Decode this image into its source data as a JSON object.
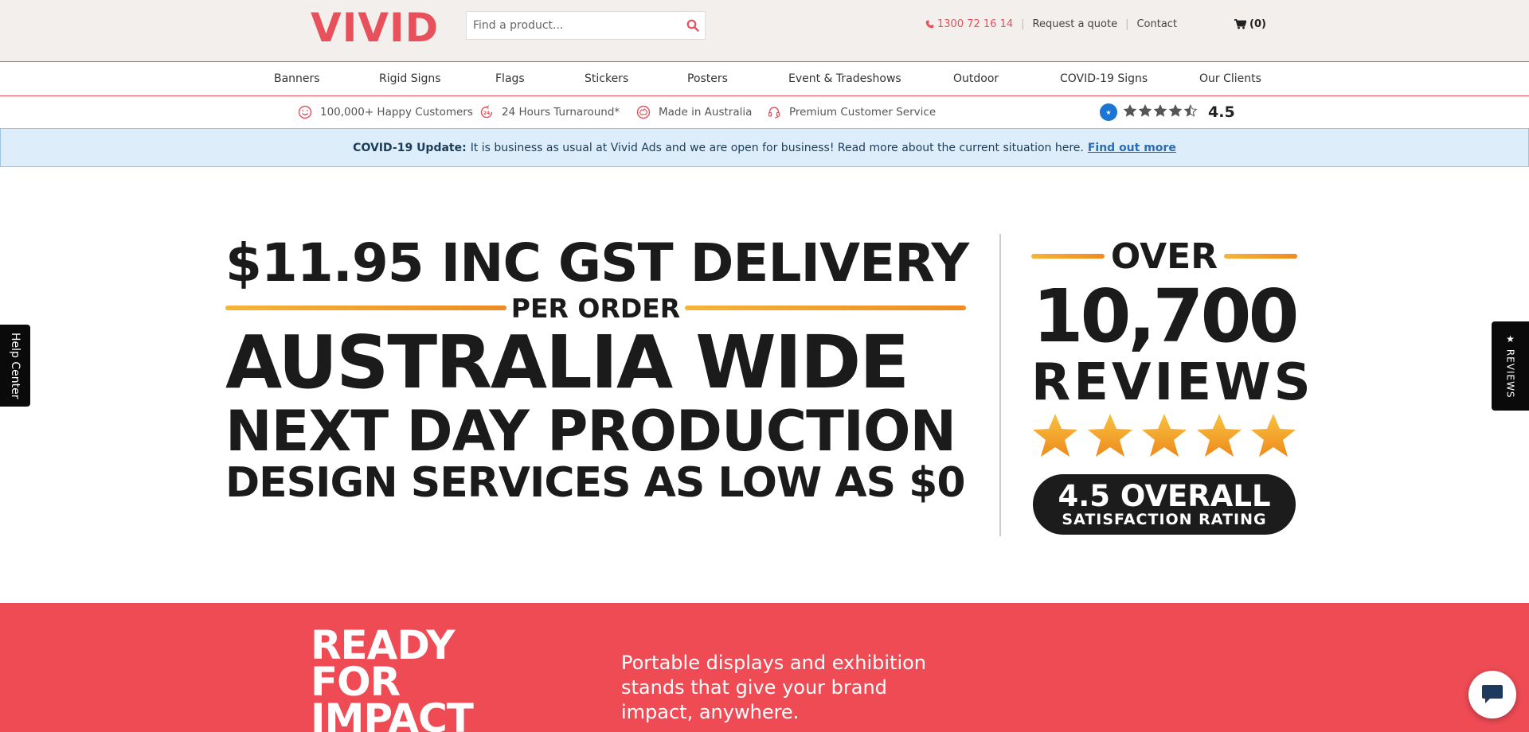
{
  "header": {
    "logo": "VIVID",
    "search_placeholder": "Find a product...",
    "phone": "1300 72 16 14",
    "request_quote": "Request a quote",
    "contact": "Contact",
    "cart_count": "(0)"
  },
  "nav": {
    "items": [
      "Banners",
      "Rigid Signs",
      "Flags",
      "Stickers",
      "Posters",
      "Event & Tradeshows",
      "Outdoor",
      "COVID-19 Signs",
      "Our Clients"
    ]
  },
  "features": {
    "items": [
      "100,000+ Happy Customers",
      "24 Hours Turnaround*",
      "Made in Australia",
      "Premium Customer Service"
    ],
    "rating_value": "4.5",
    "rating_stars": 4.5
  },
  "covid_banner": {
    "label": "COVID-19 Update:",
    "message": "It is business as usual at Vivid Ads and we are open for business! Read more about the current situation here.",
    "link": "Find out more"
  },
  "hero": {
    "line1": "$11.95 INC GST DELIVERY",
    "per_order": "PER ORDER",
    "line2": "AUSTRALIA WIDE",
    "line3": "NEXT DAY PRODUCTION",
    "line4": "DESIGN SERVICES AS LOW AS $0",
    "over": "OVER",
    "review_count": "10,700",
    "reviews_word": "REVIEWS",
    "overall_rating": "4.5 OVERALL",
    "satisfaction": "SATISFACTION RATING"
  },
  "side_tabs": {
    "help": "Help Center",
    "reviews": "★ REVIEWS"
  },
  "promo": {
    "line1": "READY",
    "line2": "FOR",
    "line3": "IMPACT",
    "description": "Portable displays and exhibition stands that give your brand impact, anywhere."
  },
  "colors": {
    "brand_red": "#e8505b",
    "promo_red": "#ee4b55",
    "covid_bg": "#deedfa",
    "star_orange": "#f29a1f"
  }
}
